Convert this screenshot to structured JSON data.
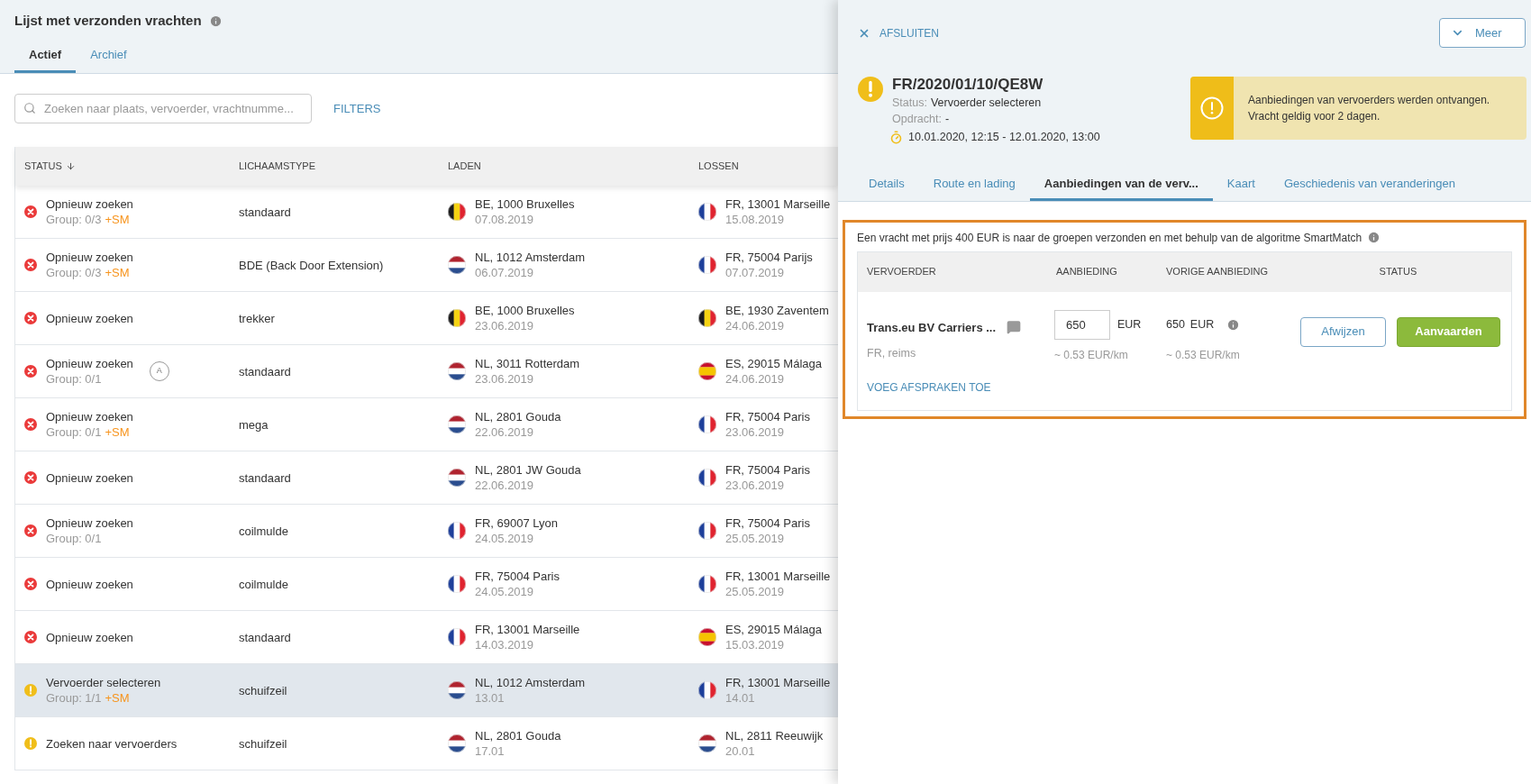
{
  "page": {
    "title": "Lijst met verzonden vrachten"
  },
  "tabs": [
    {
      "label": "Actief",
      "selected": true
    },
    {
      "label": "Archief",
      "selected": false
    }
  ],
  "search": {
    "placeholder": "Zoeken naar plaats, vervoerder, vrachtnumme..."
  },
  "filters_link": "FILTERS",
  "table": {
    "columns": [
      "STATUS",
      "LICHAAMSTYPE",
      "LADEN",
      "LOSSEN"
    ],
    "rows": [
      {
        "kind": "error",
        "status": "Opnieuw zoeken",
        "group": "Group: 0/3",
        "sm": "+SM",
        "body": "standaard",
        "load": {
          "kind": "BE",
          "place": "BE, 1000 Bruxelles",
          "date": "07.08.2019"
        },
        "unload": {
          "kind": "FR",
          "place": "FR, 13001 Marseille",
          "date": "15.08.2019"
        },
        "selected": false
      },
      {
        "kind": "error",
        "status": "Opnieuw zoeken",
        "group": "Group: 0/3",
        "sm": "+SM",
        "body": "BDE (Back Door Extension)",
        "load": {
          "kind": "NL",
          "place": "NL, 1012 Amsterdam",
          "date": "06.07.2019"
        },
        "unload": {
          "kind": "FR",
          "place": "FR, 75004 Parijs",
          "date": "07.07.2019"
        },
        "selected": false
      },
      {
        "kind": "error",
        "status": "Opnieuw zoeken",
        "body": "trekker",
        "load": {
          "kind": "BE",
          "place": "BE, 1000 Bruxelles",
          "date": "23.06.2019"
        },
        "unload": {
          "kind": "BE",
          "place": "BE, 1930 Zaventem",
          "date": "24.06.2019"
        },
        "selected": false
      },
      {
        "kind": "error",
        "status": "Opnieuw zoeken",
        "group": "Group: 0/1",
        "badge": "A",
        "body": "standaard",
        "load": {
          "kind": "NL",
          "place": "NL, 3011 Rotterdam",
          "date": "23.06.2019"
        },
        "unload": {
          "kind": "ES",
          "place": "ES, 29015 Málaga",
          "date": "24.06.2019"
        },
        "selected": false
      },
      {
        "kind": "error",
        "status": "Opnieuw zoeken",
        "group": "Group: 0/1",
        "sm": "+SM",
        "body": "mega",
        "load": {
          "kind": "NL",
          "place": "NL, 2801 Gouda",
          "date": "22.06.2019"
        },
        "unload": {
          "kind": "FR",
          "place": "FR, 75004 Paris",
          "date": "23.06.2019"
        },
        "selected": false
      },
      {
        "kind": "error",
        "status": "Opnieuw zoeken",
        "body": "standaard",
        "load": {
          "kind": "NL",
          "place": "NL, 2801 JW Gouda",
          "date": "22.06.2019"
        },
        "unload": {
          "kind": "FR",
          "place": "FR, 75004 Paris",
          "date": "23.06.2019"
        },
        "selected": false
      },
      {
        "kind": "error",
        "status": "Opnieuw zoeken",
        "group": "Group: 0/1",
        "body": "coilmulde",
        "load": {
          "kind": "FR",
          "place": "FR, 69007 Lyon",
          "date": "24.05.2019"
        },
        "unload": {
          "kind": "FR",
          "place": "FR, 75004 Paris",
          "date": "25.05.2019"
        },
        "selected": false
      },
      {
        "kind": "error",
        "status": "Opnieuw zoeken",
        "body": "coilmulde",
        "load": {
          "kind": "FR",
          "place": "FR, 75004 Paris",
          "date": "24.05.2019"
        },
        "unload": {
          "kind": "FR",
          "place": "FR, 13001 Marseille",
          "date": "25.05.2019"
        },
        "selected": false
      },
      {
        "kind": "error",
        "status": "Opnieuw zoeken",
        "body": "standaard",
        "load": {
          "kind": "FR",
          "place": "FR, 13001 Marseille",
          "date": "14.03.2019"
        },
        "unload": {
          "kind": "ES",
          "place": "ES, 29015 Málaga",
          "date": "15.03.2019"
        },
        "selected": false
      },
      {
        "kind": "warning",
        "status": "Vervoerder selecteren",
        "group": "Group: 1/1",
        "sm": "+SM",
        "body": "schuifzeil",
        "load": {
          "kind": "NL",
          "place": "NL, 1012 Amsterdam",
          "date": "13.01"
        },
        "unload": {
          "kind": "FR",
          "place": "FR, 13001 Marseille",
          "date": "14.01"
        },
        "selected": true
      },
      {
        "kind": "warning",
        "status": "Zoeken naar vervoerders",
        "body": "schuifzeil",
        "load": {
          "kind": "NL",
          "place": "NL, 2801 Gouda",
          "date": "17.01"
        },
        "unload": {
          "kind": "NL",
          "place": "NL, 2811 Reeuwijk",
          "date": "20.01"
        },
        "selected": false
      }
    ]
  },
  "detail": {
    "close": "AFSLUITEN",
    "more": "Meer",
    "id": "FR/2020/01/10/QE8W",
    "status_label": "Status:",
    "status_value": "Vervoerder selecteren",
    "order_label": "Opdracht:",
    "order_value": "-",
    "time": "10.01.2020, 12:15 - 12.01.2020, 13:00",
    "alert": "Aanbiedingen van vervoerders werden ontvangen. Vracht geldig voor 2 dagen.",
    "tabs": [
      {
        "label": "Details",
        "selected": false
      },
      {
        "label": "Route en lading",
        "selected": false
      },
      {
        "label": "Aanbiedingen van de verv...",
        "selected": true
      },
      {
        "label": "Kaart",
        "selected": false
      },
      {
        "label": "Geschiedenis van veranderingen",
        "selected": false
      }
    ],
    "offers": {
      "note": "Een vracht met prijs 400 EUR is naar de groepen verzonden en met behulp van de algoritme SmartMatch",
      "columns": [
        "VERVOERDER",
        "AANBIEDING",
        "VORIGE AANBIEDING",
        "STATUS"
      ],
      "rows": [
        {
          "carrier": "Trans.eu BV Carriers ...",
          "location": "FR, reims",
          "offer": "650",
          "currency": "EUR",
          "per_km": "~ 0.53 EUR/km",
          "prev_amount": "650",
          "prev_currency": "EUR",
          "prev_per_km": "~ 0.53 EUR/km",
          "reject": "Afwijzen",
          "accept": "Aanvaarden",
          "link": "VOEG AFSPRAKEN TOE"
        }
      ]
    }
  }
}
